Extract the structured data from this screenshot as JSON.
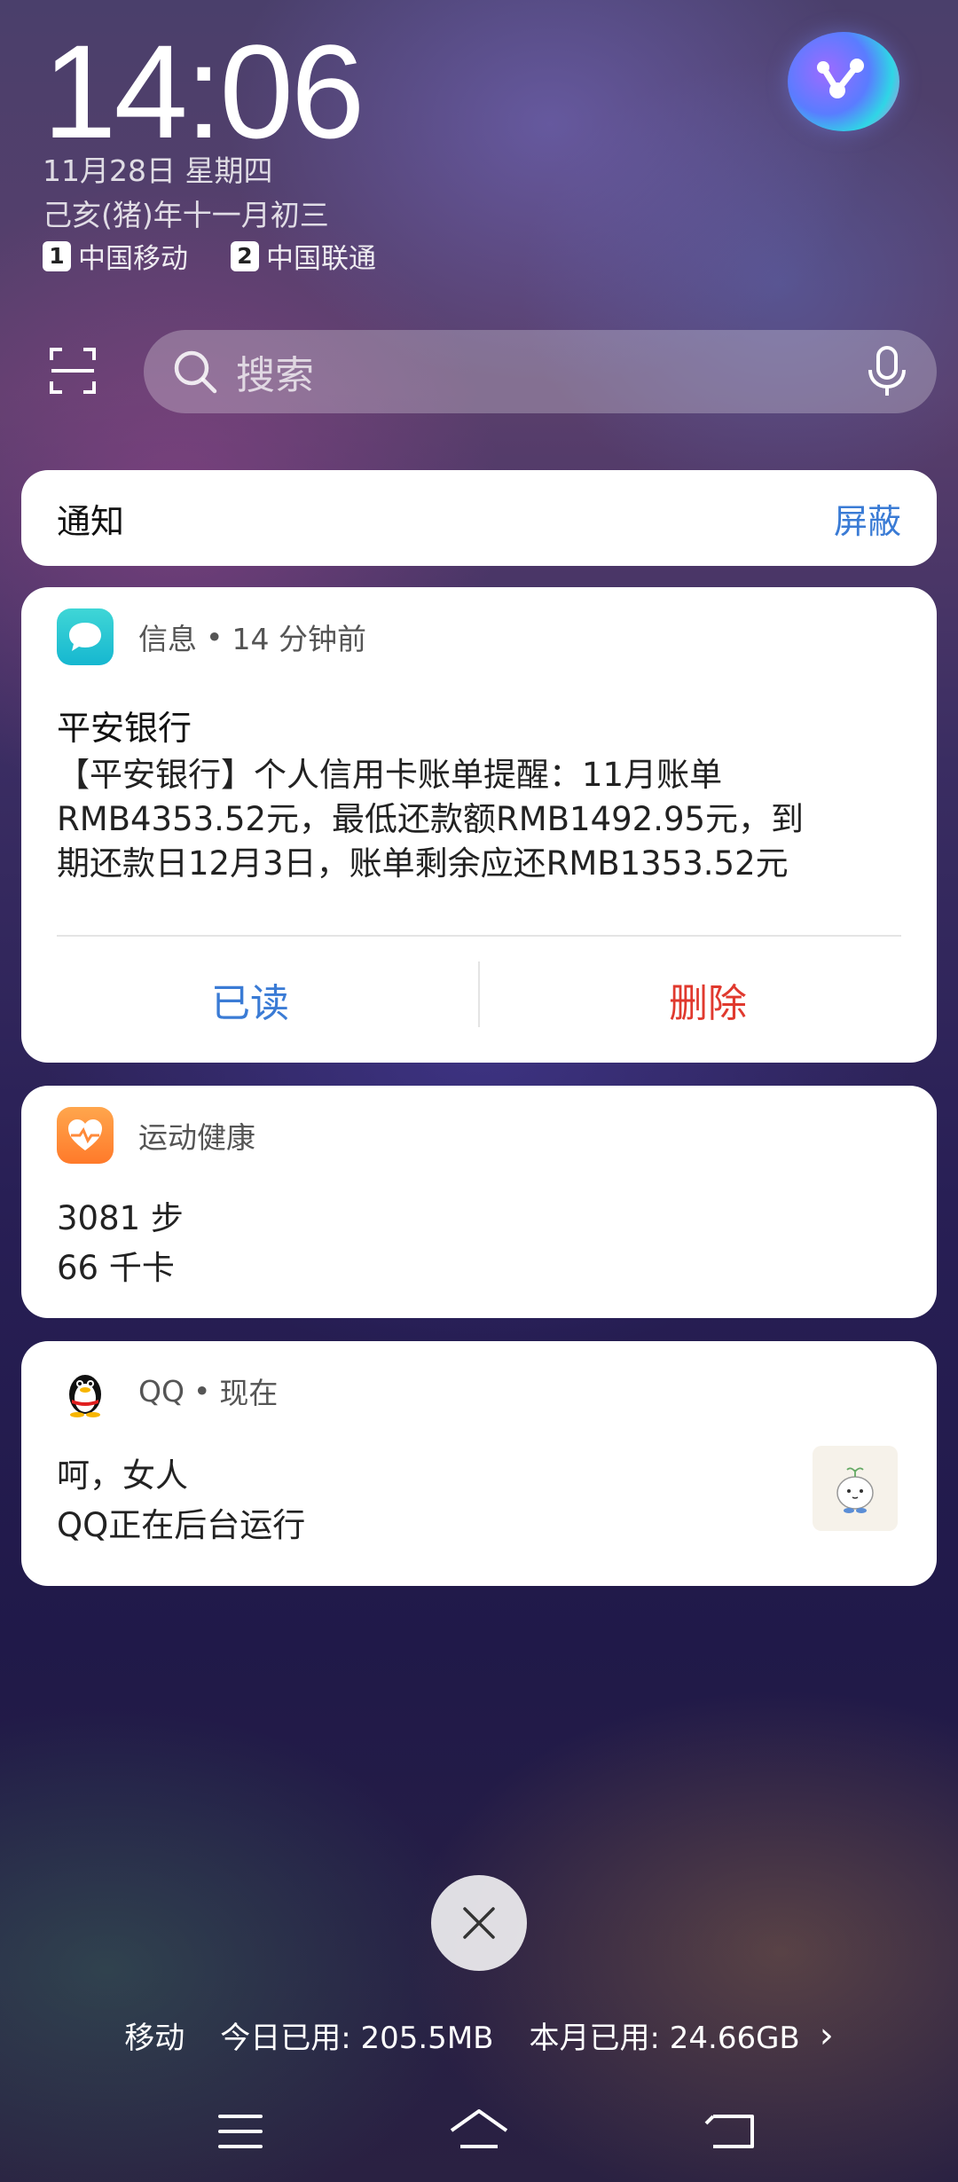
{
  "status": {
    "time": "14:06",
    "date": "11月28日 星期四",
    "lunar": "己亥(猪)年十一月初三",
    "sim1": {
      "slot": "1",
      "carrier": "中国移动"
    },
    "sim2": {
      "slot": "2",
      "carrier": "中国联通"
    }
  },
  "search": {
    "placeholder": "搜索"
  },
  "notifications_header": {
    "title": "通知",
    "action": "屏蔽"
  },
  "sms_notification": {
    "app": "信息",
    "time": "14 分钟前",
    "sender": "平安银行",
    "body_lines": [
      "【平安银行】个人信用卡账单提醒：11月账单",
      "RMB4353.52元，最低还款额RMB1492.95元，到",
      "期还款日12月3日，账单剩余应还RMB1353.52元"
    ],
    "actions": {
      "read": "已读",
      "delete": "删除"
    }
  },
  "health_notification": {
    "app": "运动健康",
    "steps": "3081 步",
    "calories": "66 千卡"
  },
  "qq_notification": {
    "app": "QQ",
    "time": "现在",
    "title": "呵，女人",
    "text": "QQ正在后台运行"
  },
  "data_usage": {
    "carrier": "移动",
    "today": "今日已用: 205.5MB",
    "month": "本月已用: 24.66GB"
  },
  "icons": {
    "scan": "scan-icon",
    "search": "search-icon",
    "mic": "mic-icon",
    "close": "close-icon",
    "chevron": "chevron-right-icon",
    "menu": "menu-icon",
    "home": "home-icon",
    "back": "back-icon"
  },
  "colors": {
    "accent_blue": "#3a7bd5",
    "delete_red": "#e0392e"
  }
}
